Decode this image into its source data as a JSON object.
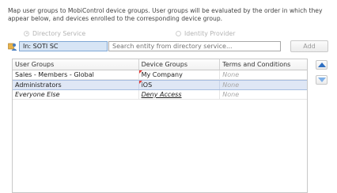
{
  "description": "Map user groups to MobiControl device groups. User groups will be evaluated by the order in which they appear below, and devices enrolled to the corresponding device group.",
  "source": {
    "directory_service_label": "Directory Service",
    "identity_provider_label": "Identity Provider",
    "selected": "directory_service"
  },
  "entity": {
    "in_label": "In: SOTI SC",
    "search_placeholder": "Search entity from directory service...",
    "add_label": "Add"
  },
  "grid": {
    "headers": [
      "User Groups",
      "Device Groups",
      "Terms and Conditions"
    ],
    "rows": [
      {
        "user_group": "Sales - Members - Global",
        "device_group": "My Company",
        "terms": "None"
      },
      {
        "user_group": "Administrators",
        "device_group": "iOS",
        "terms": "None"
      },
      {
        "user_group": "Everyone Else",
        "device_group": "Deny Access",
        "terms": "None"
      }
    ],
    "selected_row": 1
  },
  "icons": {
    "entity": "user-group-icon",
    "move_up": "arrow-up-icon",
    "move_down": "arrow-down-icon"
  },
  "colors": {
    "selection": "#dfe7f5",
    "arrow_up": "#2f6fc1",
    "arrow_down": "#7fb1e8",
    "dirty_marker": "#e53935"
  }
}
